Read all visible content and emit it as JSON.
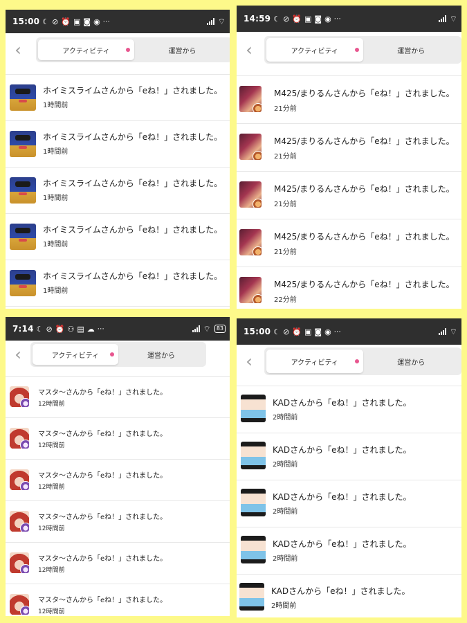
{
  "panels": [
    {
      "status_time": "15:00",
      "status_extra": "⋯",
      "tabs": {
        "active": "アクティビティ",
        "other": "運営から"
      },
      "rows": [
        {
          "message": "ホイミスライムさんから「eね！」されました。",
          "time": "1時間前"
        },
        {
          "message": "ホイミスライムさんから「eね！」されました。",
          "time": "1時間前"
        },
        {
          "message": "ホイミスライムさんから「eね！」されました。",
          "time": "1時間前"
        },
        {
          "message": "ホイミスライムさんから「eね！」されました。",
          "time": "1時間前"
        },
        {
          "message": "ホイミスライムさんから「eね！」されました。",
          "time": "1時間前"
        }
      ]
    },
    {
      "status_time": "14:59",
      "status_extra": "⋯",
      "tabs": {
        "active": "アクティビティ",
        "other": "運営から"
      },
      "rows": [
        {
          "message": "M425/まりるんさんから「eね！」されました。",
          "time": "21分前"
        },
        {
          "message": "M425/まりるんさんから「eね！」されました。",
          "time": "21分前"
        },
        {
          "message": "M425/まりるんさんから「eね！」されました。",
          "time": "21分前"
        },
        {
          "message": "M425/まりるんさんから「eね！」されました。",
          "time": "21分前"
        },
        {
          "message": "M425/まりるんさんから「eね！」されました。",
          "time": "22分前"
        }
      ]
    },
    {
      "status_time": "7:14",
      "status_extra": "⋯",
      "battery": "83",
      "tabs": {
        "active": "アクティビティ",
        "other": "運営から"
      },
      "rows": [
        {
          "message": "マスタ〜さんから「eね！」されました。",
          "time": "12時間前"
        },
        {
          "message": "マスタ〜さんから「eね！」されました。",
          "time": "12時間前"
        },
        {
          "message": "マスタ〜さんから「eね！」されました。",
          "time": "12時間前"
        },
        {
          "message": "マスタ〜さんから「eね！」されました。",
          "time": "12時間前"
        },
        {
          "message": "マスタ〜さんから「eね！」されました。",
          "time": "12時間前"
        },
        {
          "message": "マスタ〜さんから「eね！」されました。",
          "time": "12時間前"
        }
      ]
    },
    {
      "status_time": "15:00",
      "status_extra": "⋯",
      "tabs": {
        "active": "アクティビティ",
        "other": "運営から"
      },
      "rows": [
        {
          "message": "KADさんから「eね！」されました。",
          "time": "2時間前"
        },
        {
          "message": "KADさんから「eね！」されました。",
          "time": "2時間前"
        },
        {
          "message": "KADさんから「eね！」されました。",
          "time": "2時間前"
        },
        {
          "message": "KADさんから「eね！」されました。",
          "time": "2時間前"
        },
        {
          "message": "KADさんから「eね！」されました。",
          "time": "2時間前"
        }
      ]
    }
  ],
  "colors": {
    "accent_dot": "#e8568f",
    "page_bg": "#fdf98a",
    "statusbar_bg": "#2f2f2f"
  },
  "icons": [
    "moon-icon",
    "alarm-off-icon",
    "alarm-icon",
    "signal-icon",
    "wifi-icon",
    "back-arrow-icon",
    "notification-dot-icon"
  ]
}
